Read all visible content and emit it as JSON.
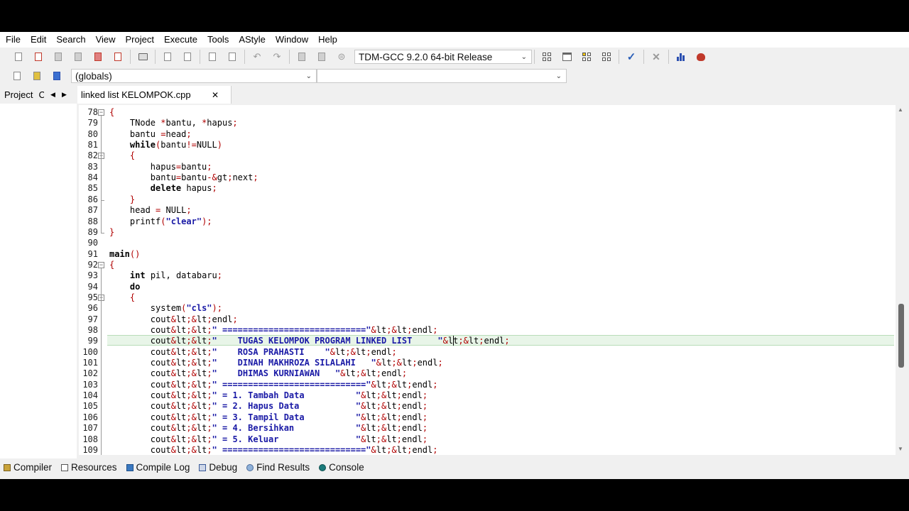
{
  "menu": [
    "File",
    "Edit",
    "Search",
    "View",
    "Project",
    "Execute",
    "Tools",
    "AStyle",
    "Window",
    "Help"
  ],
  "toolbar": {
    "compiler": "TDM-GCC 9.2.0 64-bit Release",
    "scope": "(globals)",
    "function": ""
  },
  "tabs": {
    "project": "Project",
    "classes": "C",
    "file": "linked list KELOMPOK.cpp"
  },
  "editor": {
    "lines": [
      {
        "n": "78",
        "text": "{"
      },
      {
        "n": "79",
        "text": "    TNode *bantu, *hapus;"
      },
      {
        "n": "80",
        "text": "    bantu =head;"
      },
      {
        "n": "81",
        "text": "    while(bantu!=NULL)"
      },
      {
        "n": "82",
        "text": "    {"
      },
      {
        "n": "83",
        "text": "        hapus=bantu;"
      },
      {
        "n": "84",
        "text": "        bantu=bantu->next;"
      },
      {
        "n": "85",
        "text": "        delete hapus;"
      },
      {
        "n": "86",
        "text": "    }"
      },
      {
        "n": "87",
        "text": "    head = NULL;"
      },
      {
        "n": "88",
        "text": "    printf(\"clear\");"
      },
      {
        "n": "89",
        "text": "}"
      },
      {
        "n": "90",
        "text": ""
      },
      {
        "n": "91",
        "text": "main()"
      },
      {
        "n": "92",
        "text": "{"
      },
      {
        "n": "93",
        "text": "    int pil, databaru;"
      },
      {
        "n": "94",
        "text": "    do"
      },
      {
        "n": "95",
        "text": "    {"
      },
      {
        "n": "96",
        "text": "        system(\"cls\");"
      },
      {
        "n": "97",
        "text": "        cout<<endl;"
      },
      {
        "n": "98",
        "text": "        cout<<\" ============================\"<<endl;"
      },
      {
        "n": "99",
        "text": "        cout<<\"    TUGAS KELOMPOK PROGRAM LINKED LIST     \"<<endl;"
      },
      {
        "n": "100",
        "text": "        cout<<\"    ROSA PRAHASTI    \"<<endl;"
      },
      {
        "n": "101",
        "text": "        cout<<\"    DINAH MAKHROZA SILALAHI   \"<<endl;"
      },
      {
        "n": "102",
        "text": "        cout<<\"    DHIMAS KURNIAWAN   \"<<endl;"
      },
      {
        "n": "103",
        "text": "        cout<<\" ============================\"<<endl;"
      },
      {
        "n": "104",
        "text": "        cout<<\" = 1. Tambah Data          \"<<endl;"
      },
      {
        "n": "105",
        "text": "        cout<<\" = 2. Hapus Data           \"<<endl;"
      },
      {
        "n": "106",
        "text": "        cout<<\" = 3. Tampil Data          \"<<endl;"
      },
      {
        "n": "107",
        "text": "        cout<<\" = 4. Bersihkan            \"<<endl;"
      },
      {
        "n": "108",
        "text": "        cout<<\" = 5. Keluar               \"<<endl;"
      },
      {
        "n": "109",
        "text": "        cout<<\" ============================\"<<endl;"
      }
    ],
    "current_line": "99"
  },
  "bottom_tabs": [
    "Compiler",
    "Resources",
    "Compile Log",
    "Debug",
    "Find Results",
    "Console"
  ],
  "colors": {
    "keyword": "#000000",
    "string": "#1a1aa6",
    "symbol": "#b00000",
    "line_highlight": "#e8f5e8"
  }
}
